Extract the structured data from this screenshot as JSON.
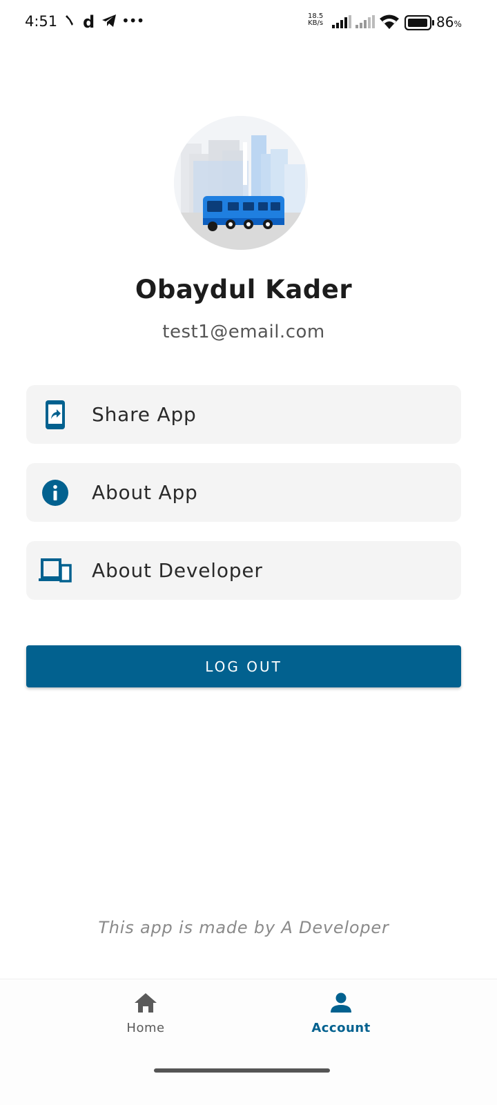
{
  "status_bar": {
    "time": "4:51",
    "speed_value": "18.5",
    "speed_unit": "KB/s",
    "battery_percent": "86",
    "battery_unit": "%"
  },
  "profile": {
    "name": "Obaydul Kader",
    "email": "test1@email.com"
  },
  "menu": [
    {
      "label": "Share App",
      "icon": "share-phone-icon"
    },
    {
      "label": "About App",
      "icon": "info-icon"
    },
    {
      "label": "About Developer",
      "icon": "devices-icon"
    }
  ],
  "logout_label": "LOG OUT",
  "credit": "This app is made by A Developer",
  "bottom_nav": {
    "items": [
      {
        "label": "Home",
        "icon": "home-icon",
        "active": false
      },
      {
        "label": "Account",
        "icon": "account-icon",
        "active": true
      }
    ]
  },
  "colors": {
    "primary": "#02618f",
    "card": "#f4f4f4",
    "avatar_bus": "#1e7fe0"
  }
}
